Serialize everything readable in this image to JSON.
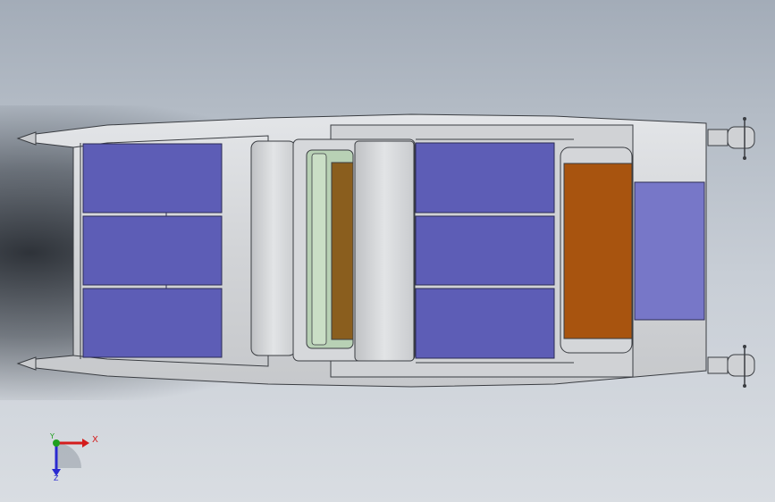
{
  "viewport": {
    "background_top": "#a3acb8",
    "background_bottom": "#d9dde2"
  },
  "model": {
    "hull_color": "#d7d9dc",
    "edge_color": "#3a3d42",
    "seat_color": "#5d5db6",
    "rear_pad_color": "#7777c8",
    "wood_color": "#a8540f",
    "dark_wood_color": "#8a5e1e",
    "glass_color": "#b8d1b5",
    "engine_color": "#cfd1d4"
  },
  "triad": {
    "x_label": "X",
    "y_label": "Y",
    "z_label": "Z",
    "x_color": "#d41c1c",
    "y_color": "#1fa01f",
    "z_color": "#2a2ad0"
  }
}
